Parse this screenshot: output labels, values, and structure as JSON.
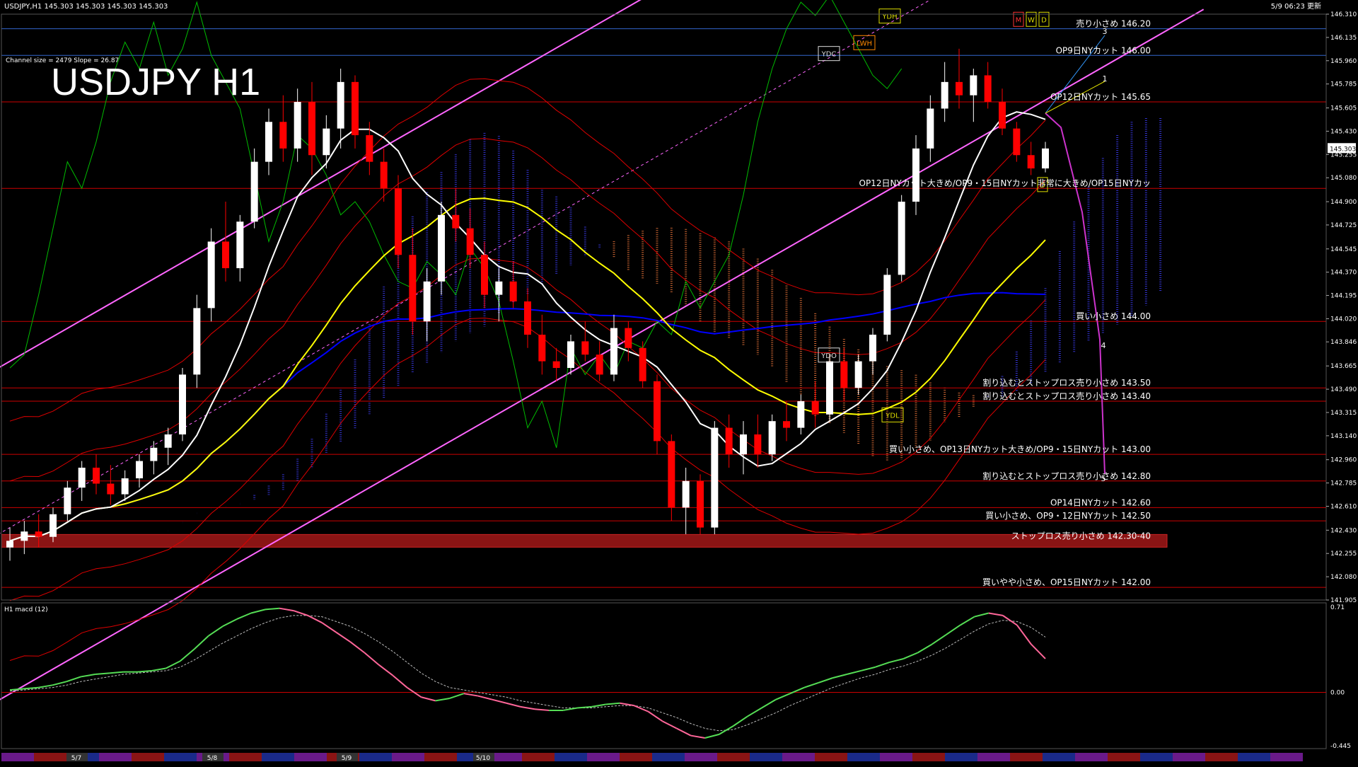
{
  "window": {
    "symbol_info": "USDJPY,H1  145.303 145.303 145.303 145.303",
    "clock": "5/9 06:23 更新",
    "channel_info": "Channel size = 2479 Slope = 26.87",
    "big_title": "USDJPY H1",
    "current_price": "145.303"
  },
  "colors": {
    "background": "#000000",
    "bull_candle": "#ffffff",
    "bear_candle": "#ff0000",
    "level_line": "#cc0000",
    "channel_line": "#ff66ff",
    "ma_short": "#ffffff",
    "ma_mid": "#ffff00",
    "ma_long": "#0000ff",
    "chikou": "#00bb00",
    "envelope": "#dd0000",
    "cloud_bull": "#3333cc",
    "cloud_bear": "#cc6633",
    "macd_up": "#55dd55",
    "macd_down": "#ff6699",
    "signal": "#bbbbbb"
  },
  "chart_data": {
    "type": "candlestick",
    "title": "USDJPY H1",
    "ylim": [
      141.905,
      146.31
    ],
    "y_ticks": [
      "146.310",
      "146.135",
      "145.960",
      "145.785",
      "145.605",
      "145.430",
      "145.255",
      "145.080",
      "144.900",
      "144.725",
      "144.545",
      "144.370",
      "144.195",
      "144.020",
      "143.846",
      "143.665",
      "143.490",
      "143.315",
      "143.140",
      "142.960",
      "142.785",
      "142.610",
      "142.430",
      "142.255",
      "142.080",
      "141.905"
    ],
    "date_labels": [
      "5/7",
      "5/8",
      "5/9",
      "5/10"
    ],
    "ohlc": [
      [
        142.3,
        142.45,
        142.2,
        142.35
      ],
      [
        142.35,
        142.5,
        142.25,
        142.42
      ],
      [
        142.42,
        142.55,
        142.3,
        142.38
      ],
      [
        142.38,
        142.6,
        142.34,
        142.55
      ],
      [
        142.55,
        142.8,
        142.5,
        142.75
      ],
      [
        142.75,
        142.95,
        142.65,
        142.9
      ],
      [
        142.9,
        143.0,
        142.7,
        142.78
      ],
      [
        142.78,
        142.92,
        142.62,
        142.7
      ],
      [
        142.7,
        142.88,
        142.65,
        142.82
      ],
      [
        142.82,
        143.0,
        142.75,
        142.95
      ],
      [
        142.95,
        143.1,
        142.85,
        143.05
      ],
      [
        143.05,
        143.2,
        142.92,
        143.15
      ],
      [
        143.15,
        143.65,
        143.1,
        143.6
      ],
      [
        143.6,
        144.2,
        143.5,
        144.1
      ],
      [
        144.1,
        144.7,
        144.0,
        144.6
      ],
      [
        144.6,
        144.9,
        144.3,
        144.4
      ],
      [
        144.4,
        144.8,
        144.3,
        144.75
      ],
      [
        144.75,
        145.3,
        144.7,
        145.2
      ],
      [
        145.2,
        145.6,
        145.1,
        145.5
      ],
      [
        145.5,
        145.7,
        145.2,
        145.3
      ],
      [
        145.3,
        145.75,
        145.2,
        145.65
      ],
      [
        145.65,
        145.8,
        145.1,
        145.25
      ],
      [
        145.25,
        145.55,
        145.15,
        145.45
      ],
      [
        145.45,
        145.9,
        145.3,
        145.8
      ],
      [
        145.8,
        145.85,
        145.3,
        145.4
      ],
      [
        145.4,
        145.5,
        145.1,
        145.2
      ],
      [
        145.2,
        145.3,
        144.9,
        145.0
      ],
      [
        145.0,
        145.1,
        144.4,
        144.5
      ],
      [
        144.5,
        144.7,
        143.9,
        144.0
      ],
      [
        144.0,
        144.4,
        143.85,
        144.3
      ],
      [
        144.3,
        144.9,
        144.2,
        144.8
      ],
      [
        144.8,
        145.0,
        144.6,
        144.7
      ],
      [
        144.7,
        144.85,
        144.4,
        144.5
      ],
      [
        144.5,
        144.6,
        144.1,
        144.2
      ],
      [
        144.2,
        144.4,
        144.0,
        144.3
      ],
      [
        144.3,
        144.45,
        144.1,
        144.15
      ],
      [
        144.15,
        144.25,
        143.8,
        143.9
      ],
      [
        143.9,
        144.05,
        143.6,
        143.7
      ],
      [
        143.7,
        143.8,
        143.55,
        143.65
      ],
      [
        143.65,
        143.9,
        143.6,
        143.85
      ],
      [
        143.85,
        144.0,
        143.7,
        143.75
      ],
      [
        143.75,
        143.85,
        143.55,
        143.6
      ],
      [
        143.6,
        144.05,
        143.55,
        143.95
      ],
      [
        143.95,
        144.0,
        143.7,
        143.8
      ],
      [
        143.8,
        143.85,
        143.5,
        143.55
      ],
      [
        143.55,
        143.6,
        143.0,
        143.1
      ],
      [
        143.1,
        143.15,
        142.5,
        142.6
      ],
      [
        142.6,
        142.9,
        142.4,
        142.8
      ],
      [
        142.8,
        142.85,
        142.4,
        142.45
      ],
      [
        142.45,
        143.25,
        142.4,
        143.2
      ],
      [
        143.2,
        143.3,
        142.9,
        143.0
      ],
      [
        143.0,
        143.25,
        142.85,
        143.15
      ],
      [
        143.15,
        143.3,
        142.9,
        143.0
      ],
      [
        143.0,
        143.3,
        142.95,
        143.25
      ],
      [
        143.25,
        143.4,
        143.1,
        143.2
      ],
      [
        143.2,
        143.45,
        143.15,
        143.4
      ],
      [
        143.4,
        143.55,
        143.2,
        143.3
      ],
      [
        143.3,
        143.75,
        143.25,
        143.7
      ],
      [
        143.7,
        143.8,
        143.4,
        143.5
      ],
      [
        143.5,
        143.75,
        143.45,
        143.7
      ],
      [
        143.7,
        143.95,
        143.6,
        143.9
      ],
      [
        143.9,
        144.4,
        143.85,
        144.35
      ],
      [
        144.35,
        144.95,
        144.3,
        144.9
      ],
      [
        144.9,
        145.4,
        144.8,
        145.3
      ],
      [
        145.3,
        145.7,
        145.2,
        145.6
      ],
      [
        145.6,
        145.95,
        145.5,
        145.8
      ],
      [
        145.8,
        146.05,
        145.6,
        145.7
      ],
      [
        145.7,
        145.9,
        145.5,
        145.85
      ],
      [
        145.85,
        145.95,
        145.6,
        145.65
      ],
      [
        145.65,
        145.75,
        145.4,
        145.45
      ],
      [
        145.45,
        145.5,
        145.2,
        145.25
      ],
      [
        145.25,
        145.35,
        145.1,
        145.15
      ],
      [
        145.15,
        145.35,
        145.12,
        145.3
      ]
    ],
    "levels": [
      {
        "price": 146.2,
        "label": "売り小さめ 146.20",
        "style": "blue"
      },
      {
        "price": 146.0,
        "label": "OP9日NYカット 146.00",
        "style": "blue"
      },
      {
        "price": 145.65,
        "label": "OP12日NYカット 145.65",
        "style": "red"
      },
      {
        "price": 145.0,
        "label": "OP12日NYカット大きめ/OP9・15日NYカット非常に大きめ/OP15日NYカッ",
        "style": "red"
      },
      {
        "price": 144.0,
        "label": "買い小さめ 144.00",
        "style": "red"
      },
      {
        "price": 143.5,
        "label": "割り込むとストップロス売り小さめ 143.50",
        "style": "red"
      },
      {
        "price": 143.4,
        "label": "割り込むとストップロス売り小さめ 143.40",
        "style": "red"
      },
      {
        "price": 143.0,
        "label": "買い小さめ、OP13日NYカット大きめ/OP9・15日NYカット 143.00",
        "style": "red"
      },
      {
        "price": 142.8,
        "label": "割り込むとストップロス売り小さめ 142.80",
        "style": "red"
      },
      {
        "price": 142.6,
        "label": "OP14日NYカット 142.60",
        "style": "red"
      },
      {
        "price": 142.5,
        "label": "買い小さめ、OP9・12日NYカット 142.50",
        "style": "red"
      },
      {
        "price": 142.35,
        "label": "ストップロス売り小さめ 142.30-40",
        "style": "band"
      },
      {
        "price": 142.0,
        "label": "買いやや小さめ、OP15日NYカット 142.00",
        "style": "red"
      }
    ],
    "markers": [
      {
        "label": "YDH",
        "price": 146.2,
        "color": "#dddd00"
      },
      {
        "label": "LWH",
        "price": 146.0,
        "color": "#ff8800"
      },
      {
        "label": "YDC",
        "price": 145.95,
        "color": "#dddddd"
      },
      {
        "label": "YDO",
        "price": 143.8,
        "color": "#dddddd"
      },
      {
        "label": "YDL",
        "price": 143.35,
        "color": "#dddd00"
      },
      {
        "label": "M",
        "price": 146.25,
        "color": "#ff3333"
      },
      {
        "label": "W",
        "price": 146.25,
        "color": "#dddd00"
      },
      {
        "label": "D",
        "price": 146.25,
        "color": "#dddd00"
      },
      {
        "label": "D",
        "price": 145.05,
        "color": "#dddd00"
      }
    ],
    "wave_labels": [
      "3",
      "1",
      "4",
      "5"
    ],
    "macd": {
      "label": "H1  macd (12)",
      "ylim": [
        -0.445,
        0.71
      ],
      "ticks": [
        "0.71",
        "0.00",
        "-0.445"
      ],
      "values": [
        0.02,
        0.03,
        0.04,
        0.06,
        0.09,
        0.13,
        0.15,
        0.16,
        0.17,
        0.17,
        0.18,
        0.2,
        0.26,
        0.36,
        0.47,
        0.55,
        0.61,
        0.66,
        0.69,
        0.7,
        0.68,
        0.64,
        0.58,
        0.5,
        0.42,
        0.33,
        0.23,
        0.14,
        0.04,
        -0.04,
        -0.07,
        -0.05,
        -0.01,
        -0.03,
        -0.06,
        -0.09,
        -0.12,
        -0.14,
        -0.15,
        -0.15,
        -0.13,
        -0.12,
        -0.1,
        -0.09,
        -0.11,
        -0.16,
        -0.24,
        -0.3,
        -0.36,
        -0.38,
        -0.35,
        -0.28,
        -0.2,
        -0.13,
        -0.06,
        -0.01,
        0.04,
        0.08,
        0.12,
        0.15,
        0.18,
        0.21,
        0.25,
        0.28,
        0.33,
        0.4,
        0.48,
        0.56,
        0.63,
        0.66,
        0.64,
        0.56,
        0.4,
        0.28
      ],
      "signal": [
        0.01,
        0.02,
        0.03,
        0.04,
        0.06,
        0.09,
        0.11,
        0.13,
        0.15,
        0.16,
        0.17,
        0.18,
        0.21,
        0.27,
        0.34,
        0.41,
        0.47,
        0.53,
        0.58,
        0.62,
        0.64,
        0.64,
        0.63,
        0.59,
        0.55,
        0.49,
        0.42,
        0.34,
        0.25,
        0.16,
        0.09,
        0.04,
        0.02,
        0.0,
        -0.02,
        -0.04,
        -0.07,
        -0.09,
        -0.11,
        -0.13,
        -0.13,
        -0.13,
        -0.12,
        -0.11,
        -0.11,
        -0.13,
        -0.17,
        -0.21,
        -0.26,
        -0.3,
        -0.32,
        -0.31,
        -0.27,
        -0.22,
        -0.17,
        -0.11,
        -0.06,
        -0.01,
        0.04,
        0.08,
        0.12,
        0.15,
        0.19,
        0.22,
        0.26,
        0.31,
        0.37,
        0.44,
        0.51,
        0.57,
        0.6,
        0.59,
        0.54,
        0.46
      ]
    }
  }
}
